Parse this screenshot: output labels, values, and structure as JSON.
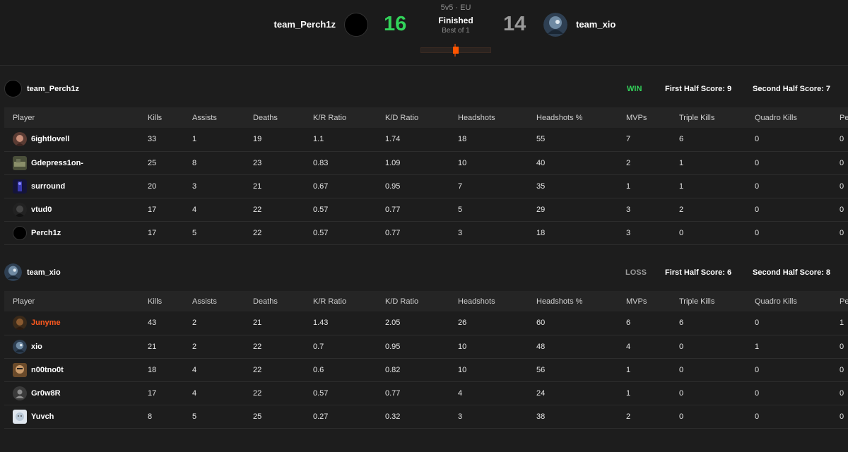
{
  "match": {
    "mode": "5v5 · EU",
    "status": "Finished",
    "best_of": "Best of 1",
    "team1": {
      "name": "team_Perch1z",
      "score": "16"
    },
    "team2": {
      "name": "team_xio",
      "score": "14"
    }
  },
  "columns": [
    "Player",
    "Kills",
    "Assists",
    "Deaths",
    "K/R Ratio",
    "K/D Ratio",
    "Headshots",
    "Headshots %",
    "MVPs",
    "Triple Kills",
    "Quadro Kills",
    "Pe"
  ],
  "teams": [
    {
      "name": "team_Perch1z",
      "result": "WIN",
      "first_half": "First Half Score: 9",
      "second_half": "Second Half Score: 7",
      "players": [
        {
          "name": "6ightlovell",
          "kills": "33",
          "assists": "1",
          "deaths": "19",
          "kr": "1.1",
          "kd": "1.74",
          "hs": "18",
          "hs_pct": "55",
          "mvps": "7",
          "triple": "6",
          "quadro": "0",
          "penta": "0"
        },
        {
          "name": "Gdepress1on-",
          "kills": "25",
          "assists": "8",
          "deaths": "23",
          "kr": "0.83",
          "kd": "1.09",
          "hs": "10",
          "hs_pct": "40",
          "mvps": "2",
          "triple": "1",
          "quadro": "0",
          "penta": "0"
        },
        {
          "name": "surround",
          "kills": "20",
          "assists": "3",
          "deaths": "21",
          "kr": "0.67",
          "kd": "0.95",
          "hs": "7",
          "hs_pct": "35",
          "mvps": "1",
          "triple": "1",
          "quadro": "0",
          "penta": "0"
        },
        {
          "name": "vtud0",
          "kills": "17",
          "assists": "4",
          "deaths": "22",
          "kr": "0.57",
          "kd": "0.77",
          "hs": "5",
          "hs_pct": "29",
          "mvps": "3",
          "triple": "2",
          "quadro": "0",
          "penta": "0"
        },
        {
          "name": "Perch1z",
          "kills": "17",
          "assists": "5",
          "deaths": "22",
          "kr": "0.57",
          "kd": "0.77",
          "hs": "3",
          "hs_pct": "18",
          "mvps": "3",
          "triple": "0",
          "quadro": "0",
          "penta": "0"
        }
      ]
    },
    {
      "name": "team_xio",
      "result": "LOSS",
      "first_half": "First Half Score: 6",
      "second_half": "Second Half Score: 8",
      "players": [
        {
          "name": "Junyme",
          "kills": "43",
          "assists": "2",
          "deaths": "21",
          "kr": "1.43",
          "kd": "2.05",
          "hs": "26",
          "hs_pct": "60",
          "mvps": "6",
          "triple": "6",
          "quadro": "0",
          "penta": "1"
        },
        {
          "name": "xio",
          "kills": "21",
          "assists": "2",
          "deaths": "22",
          "kr": "0.7",
          "kd": "0.95",
          "hs": "10",
          "hs_pct": "48",
          "mvps": "4",
          "triple": "0",
          "quadro": "1",
          "penta": "0"
        },
        {
          "name": "n00tno0t",
          "kills": "18",
          "assists": "4",
          "deaths": "22",
          "kr": "0.6",
          "kd": "0.82",
          "hs": "10",
          "hs_pct": "56",
          "mvps": "1",
          "triple": "0",
          "quadro": "0",
          "penta": "0"
        },
        {
          "name": "Gr0w8R",
          "kills": "17",
          "assists": "4",
          "deaths": "22",
          "kr": "0.57",
          "kd": "0.77",
          "hs": "4",
          "hs_pct": "24",
          "mvps": "1",
          "triple": "0",
          "quadro": "0",
          "penta": "0"
        },
        {
          "name": "Yuvch",
          "kills": "8",
          "assists": "5",
          "deaths": "25",
          "kr": "0.27",
          "kd": "0.32",
          "hs": "3",
          "hs_pct": "38",
          "mvps": "2",
          "triple": "0",
          "quadro": "0",
          "penta": "0"
        }
      ]
    }
  ],
  "colors": {
    "background": "#1d1d1d",
    "win": "#32d35a",
    "loss": "#9a9a9a",
    "accent": "#ff5500",
    "highlight_player": "#ff5a1f"
  }
}
